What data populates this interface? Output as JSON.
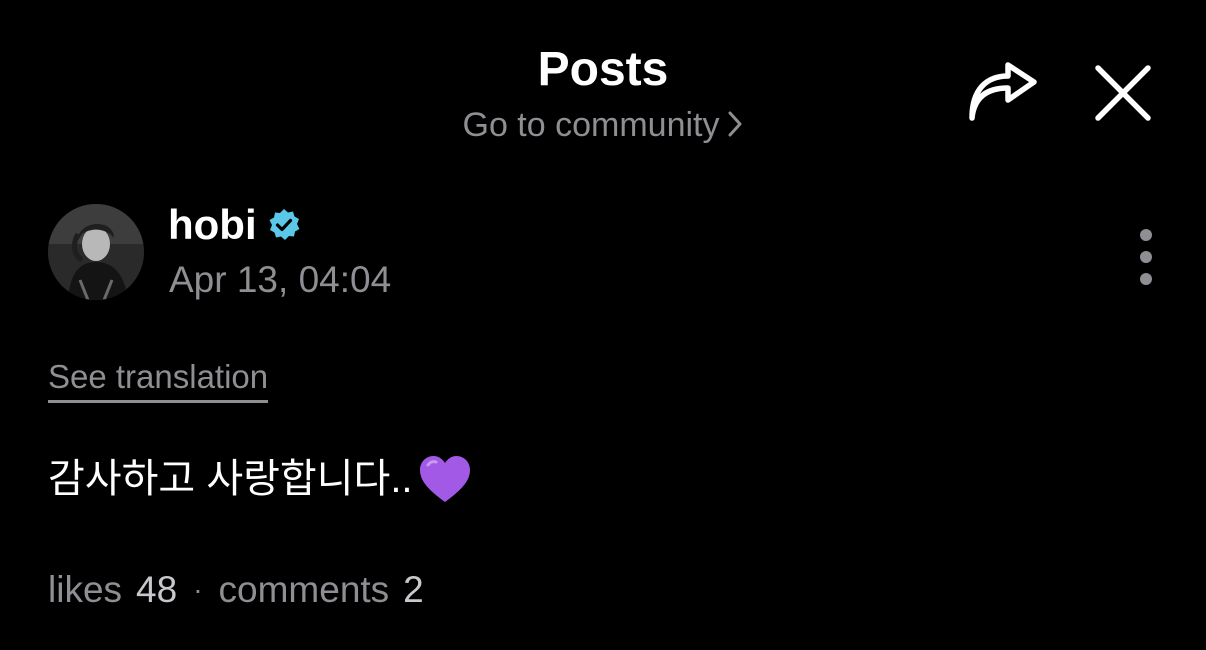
{
  "header": {
    "title": "Posts",
    "community_link": "Go to community"
  },
  "post": {
    "author": "hobi",
    "verified": true,
    "timestamp": "Apr 13, 04:04",
    "see_translation": "See translation",
    "text": "감사하고 사랑합니다..",
    "emoji": "purple-heart-icon",
    "stats": {
      "likes_label": "likes",
      "likes_count": "48",
      "separator": "·",
      "comments_label": "comments",
      "comments_count": "2"
    }
  },
  "colors": {
    "background": "#000000",
    "primary_text": "#ffffff",
    "secondary_text": "#8e8e93",
    "verified_badge": "#5ac8e6",
    "heart": "#a259e6"
  }
}
